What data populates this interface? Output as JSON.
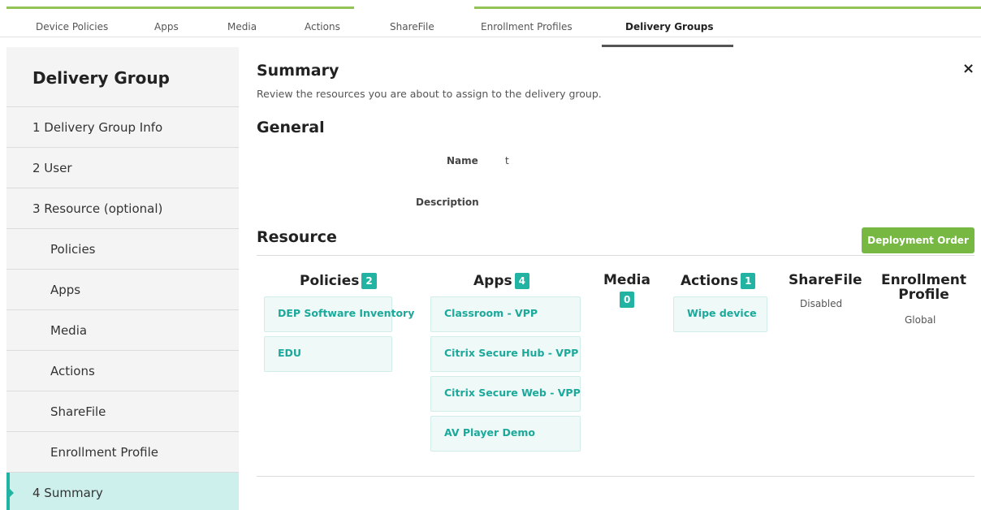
{
  "top_tabs": [
    {
      "label": "Device Policies"
    },
    {
      "label": "Apps"
    },
    {
      "label": "Media"
    },
    {
      "label": "Actions"
    },
    {
      "label": "ShareFile"
    },
    {
      "label": "Enrollment Profiles"
    },
    {
      "label": "Delivery Groups",
      "active": true
    }
  ],
  "colors": {
    "accent_green": "#93c356",
    "teal": "#22b3a3",
    "button_green": "#77b843",
    "active_bg": "#cdf0ec"
  },
  "sidebar": {
    "title": "Delivery Group",
    "items": [
      {
        "label": "1  Delivery Group Info"
      },
      {
        "label": "2  User"
      },
      {
        "label": "3  Resource (optional)"
      },
      {
        "label": "Policies"
      },
      {
        "label": "Apps"
      },
      {
        "label": "Media"
      },
      {
        "label": "Actions"
      },
      {
        "label": "ShareFile"
      },
      {
        "label": "Enrollment Profile"
      },
      {
        "label": "4  Summary",
        "active": true
      }
    ]
  },
  "main": {
    "close_icon": "×",
    "title": "Summary",
    "subtitle": "Review the resources you are about to assign to the delivery group.",
    "general_heading": "General",
    "name_label": "Name",
    "name_value": "t",
    "description_label": "Description",
    "description_value": "",
    "resource_heading": "Resource",
    "deployment_order_button": "Deployment Order",
    "columns": {
      "policies": {
        "title": "Policies",
        "count": "2",
        "items": [
          "DEP Software Inventory",
          "EDU"
        ]
      },
      "apps": {
        "title": "Apps",
        "count": "4",
        "items": [
          "Classroom - VPP",
          "Citrix Secure Hub - VPP",
          "Citrix Secure Web - VPP",
          "AV Player Demo"
        ]
      },
      "media": {
        "title": "Media",
        "count": "0"
      },
      "actions": {
        "title": "Actions",
        "count": "1",
        "items": [
          "Wipe device"
        ]
      },
      "sharefile": {
        "title": "ShareFile",
        "status": "Disabled"
      },
      "enrollment": {
        "title_line1": "Enrollment",
        "title_line2": "Profile",
        "status": "Global"
      }
    }
  }
}
